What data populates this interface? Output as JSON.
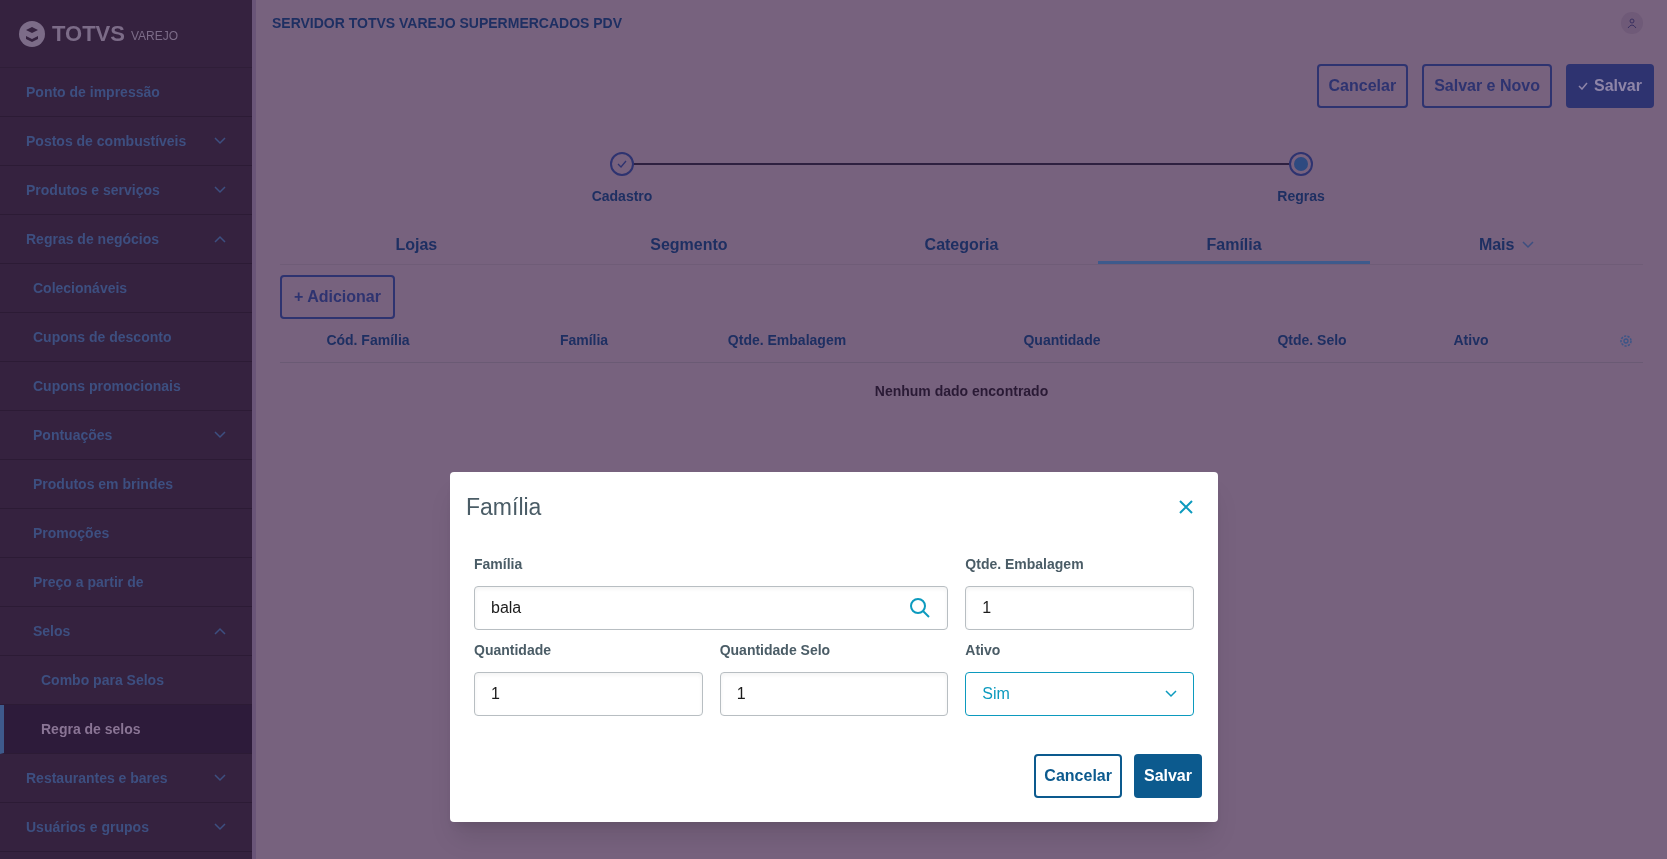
{
  "logo": {
    "brand": "TOTVS",
    "product": "VAREJO"
  },
  "sidebar": {
    "items": [
      {
        "label": "Ponto de impressão",
        "selected": false
      },
      {
        "label": "Postos de combustíveis",
        "selected": false,
        "expanded": false
      },
      {
        "label": "Produtos e serviços",
        "selected": false,
        "expanded": false
      },
      {
        "label": "Regras de negócios",
        "selected": false,
        "expanded": true,
        "children": [
          {
            "label": "Colecionáveis",
            "selected": false
          },
          {
            "label": "Cupons de desconto",
            "selected": false
          },
          {
            "label": "Cupons promocionais",
            "selected": false
          },
          {
            "label": "Pontuações",
            "selected": false,
            "expanded": false
          },
          {
            "label": "Produtos em brindes",
            "selected": false
          },
          {
            "label": "Promoções",
            "selected": false
          },
          {
            "label": "Preço a partir de",
            "selected": false
          },
          {
            "label": "Selos",
            "selected": false,
            "expanded": true,
            "children": [
              {
                "label": "Combo para Selos",
                "selected": false
              },
              {
                "label": "Regra de selos",
                "selected": true
              }
            ]
          }
        ]
      },
      {
        "label": "Restaurantes e bares",
        "selected": false,
        "expanded": false
      },
      {
        "label": "Usuários e grupos",
        "selected": false,
        "expanded": false
      }
    ]
  },
  "header": {
    "title": "SERVIDOR TOTVS VAREJO SUPERMERCADOS PDV"
  },
  "actions": [
    {
      "label": "Cancelar",
      "kind": "secondary"
    },
    {
      "label": "Salvar e Novo",
      "kind": "secondary"
    },
    {
      "label": "Salvar",
      "kind": "primary"
    }
  ],
  "stepper": [
    {
      "label": "Cadastro",
      "done": true,
      "selected": false
    },
    {
      "label": "Regras",
      "done": false,
      "selected": true
    }
  ],
  "tabs": [
    {
      "label": "Lojas",
      "selected": false,
      "kind": "tab"
    },
    {
      "label": "Segmento",
      "selected": false,
      "kind": "tab"
    },
    {
      "label": "Categoria",
      "selected": false,
      "kind": "tab"
    },
    {
      "label": "Família",
      "selected": true,
      "kind": "tab"
    },
    {
      "label": "Mais",
      "selected": false,
      "kind": "menu"
    }
  ],
  "add_button": "+ Adicionar",
  "table": {
    "columns": [
      "Cód. Família",
      "Família",
      "Qtde. Embalagem",
      "Quantidade",
      "Qtde. Selo",
      "Ativo"
    ],
    "empty_message": "Nenhum dado encontrado"
  },
  "dialog": {
    "title": "Família",
    "fields": [
      {
        "label": "Família",
        "value": "bala",
        "kind": "search"
      },
      {
        "label": "Qtde. Embalagem",
        "value": "1",
        "kind": "text"
      },
      {
        "label": "Quantidade",
        "value": "1",
        "kind": "text"
      },
      {
        "label": "Quantidade Selo",
        "value": "1",
        "kind": "text"
      },
      {
        "label": "Ativo",
        "value": "Sim",
        "kind": "select"
      }
    ],
    "buttons": [
      {
        "label": "Cancelar",
        "kind": "secondary"
      },
      {
        "label": "Salvar",
        "kind": "primary"
      }
    ]
  }
}
